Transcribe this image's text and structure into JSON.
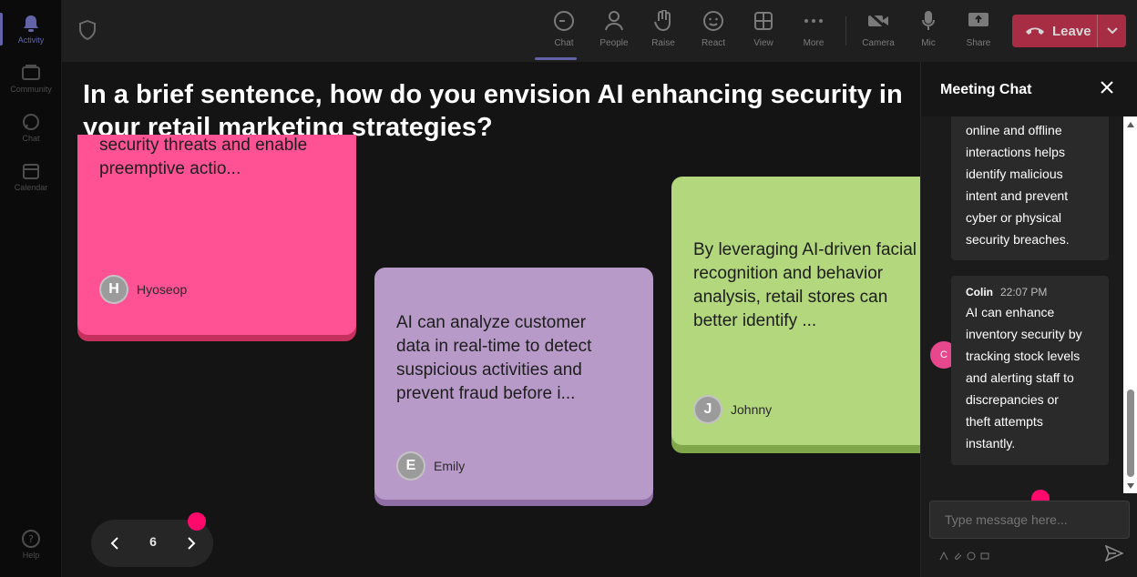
{
  "rail": {
    "items": [
      {
        "label": "Activity",
        "icon": "bell-icon"
      },
      {
        "label": "Community",
        "icon": "community-icon"
      },
      {
        "label": "Chat",
        "icon": "chat-icon"
      },
      {
        "label": "Calendar",
        "icon": "calendar-icon"
      }
    ],
    "help_label": "Help"
  },
  "toolbar": {
    "chat": "Chat",
    "people": "People",
    "raise": "Raise",
    "react": "React",
    "view": "View",
    "more": "More",
    "camera": "Camera",
    "mic": "Mic",
    "share": "Share",
    "leave": "Leave"
  },
  "question": "In a brief sentence, how do you envision AI enhancing security in your retail marketing strategies?",
  "cards": [
    {
      "text": "security threats and enable\npreemptive actio...",
      "author": "Hyoseop",
      "initial": "H",
      "color": "#ff5295"
    },
    {
      "text": "AI can analyze customer\ndata in real-time to detect\nsuspicious activities and\nprevent fraud before i...",
      "author": "Emily",
      "initial": "E",
      "color": "#b79ac8"
    },
    {
      "text": "By leveraging AI-driven facial\nrecognition and behavior\nanalysis, retail stores can\nbetter identify ...",
      "author": "Johnny",
      "initial": "J",
      "color": "#b2d77c"
    }
  ],
  "pager": {
    "page": "6"
  },
  "chat": {
    "title": "Meeting Chat",
    "messages": [
      {
        "text": "online and offline\ninteractions helps\nidentify malicious\nintent and prevent\ncyber or physical\nsecurity breaches."
      },
      {
        "sender": "Colin",
        "initial": "C",
        "time": "22:07 PM",
        "text": "AI can enhance\ninventory security by\ntracking stock levels\nand alerting staff to\ndiscrepancies or\ntheft attempts\ninstantly."
      }
    ],
    "placeholder": "Type message here..."
  },
  "colors": {
    "leave": "#c4314b",
    "accent": "#6264a7",
    "notification_dot": "#ff0a6c"
  }
}
